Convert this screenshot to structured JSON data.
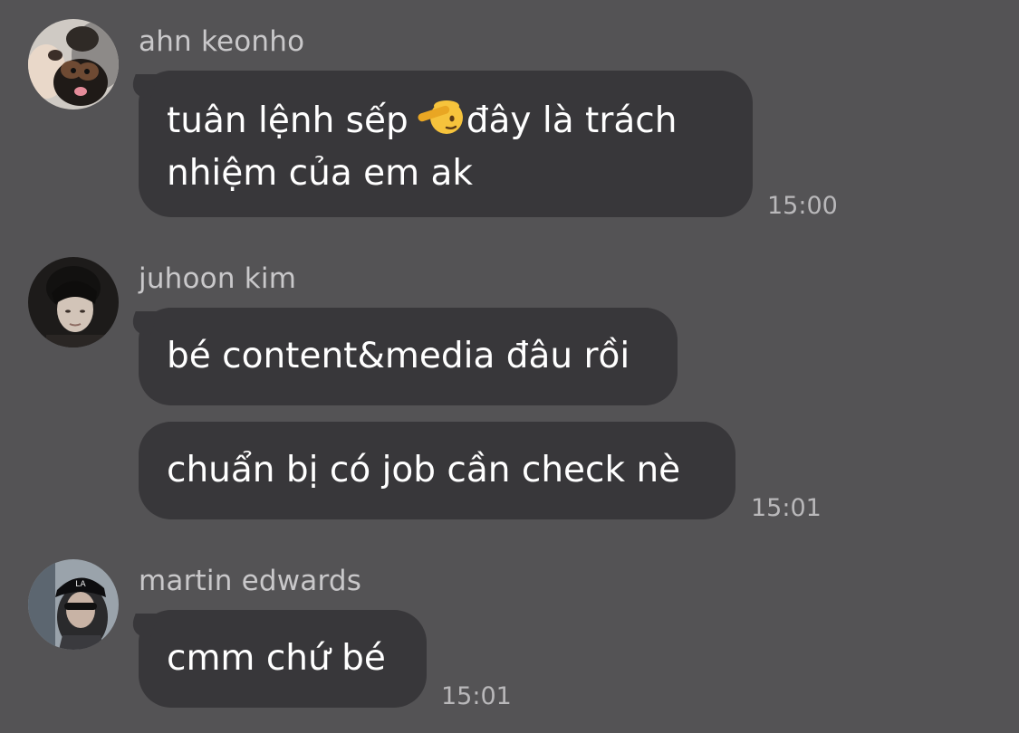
{
  "messages": [
    {
      "sender": "ahn keonho",
      "avatar": "avatar-ahn-keonho",
      "bubbles": [
        {
          "line1_before_emoji": "tuân lệnh sếp",
          "emoji": "saluting-face-icon",
          "line1_after_emoji": "đây là trách",
          "line2": "nhiệm của em ak"
        }
      ],
      "time": "15:00"
    },
    {
      "sender": "juhoon kim",
      "avatar": "avatar-juhoon-kim",
      "bubbles": [
        {
          "text": "bé content&media đâu rồi"
        },
        {
          "text": "chuẩn bị có job cần check nè"
        }
      ],
      "time": "15:01"
    },
    {
      "sender": "martin edwards",
      "avatar": "avatar-martin-edwards",
      "bubbles": [
        {
          "text": "cmm chứ bé"
        }
      ],
      "time": "15:01"
    }
  ],
  "colors": {
    "background": "#545355",
    "bubble": "#38373a",
    "text": "#ffffff",
    "sender": "#c9c8ca",
    "time": "#b9b8ba",
    "emoji": "#f6c33c"
  }
}
